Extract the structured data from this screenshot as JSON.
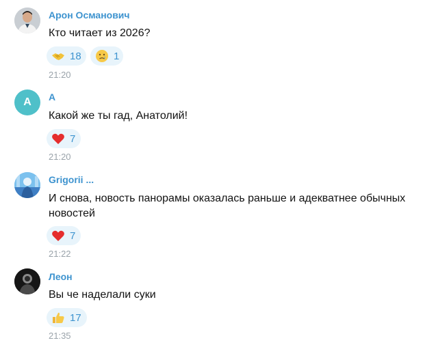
{
  "messages": [
    {
      "author": "Арон Османович",
      "avatar_icon": "man-portrait-avatar",
      "text": "Кто читает из 2026?",
      "reactions": [
        {
          "emoji": "handshake-emoji",
          "count": "18"
        },
        {
          "emoji": "crying-face-emoji",
          "count": "1"
        }
      ],
      "time": "21:20"
    },
    {
      "author": "А",
      "avatar_letter": "А",
      "avatar_color": "#4fc0c9",
      "text": "Какой же ты гад, Анатолий!",
      "reactions": [
        {
          "emoji": "red-heart-emoji",
          "count": "7"
        }
      ],
      "time": "21:20"
    },
    {
      "author": "Grigorii ...",
      "avatar_icon": "blue-photo-avatar",
      "text_lines": [
        "И снова, новость панорамы оказалась раньше и адекватнее обычных",
        "новостей"
      ],
      "reactions": [
        {
          "emoji": "red-heart-emoji",
          "count": "7"
        }
      ],
      "time": "21:22"
    },
    {
      "author": "Леон",
      "avatar_icon": "dark-photo-avatar",
      "text": "Вы че наделали суки",
      "reactions": [
        {
          "emoji": "thumbs-up-emoji",
          "count": "17"
        }
      ],
      "time": "21:35"
    }
  ]
}
